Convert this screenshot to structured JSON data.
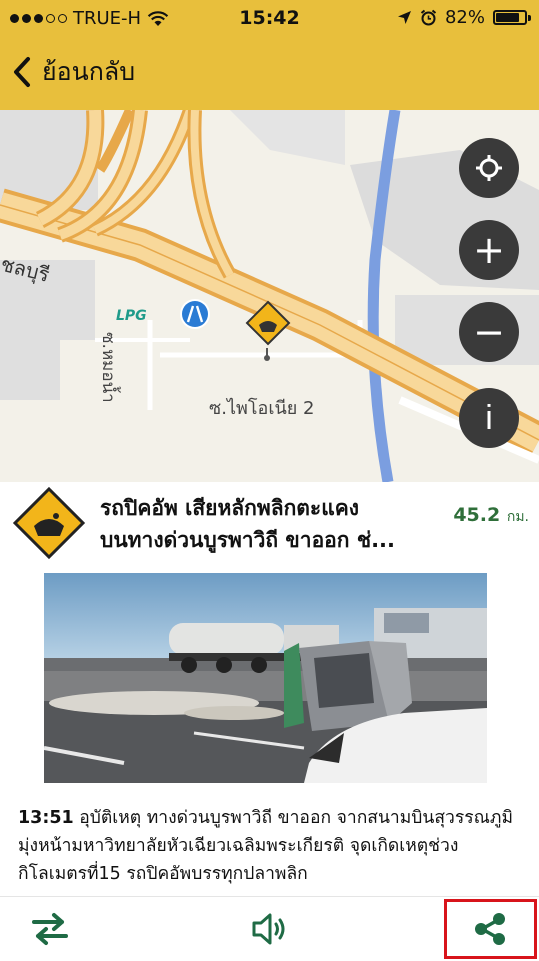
{
  "status": {
    "carrier": "TRUE-H",
    "time": "15:42",
    "battery": "82%",
    "battery_level": 0.82
  },
  "nav": {
    "back_label": "ย้อนกลับ"
  },
  "map": {
    "road_label_1": "-ชลบุรี",
    "road_label_2": "ซ.หมอน้ำ",
    "road_label_3": "ซ.ไพโอเนีย 2",
    "lpg_label": "LPG",
    "buttons": {
      "locate": "locate-icon",
      "zoom_in": "+",
      "zoom_out": "−",
      "info": "i"
    }
  },
  "incident": {
    "title": "รถปิคอัพ เสียหลักพลิกตะแคง\nบนทางด่วนบูรพาวิถี ขาออก ช่...",
    "distance_value": "45.2",
    "distance_unit": "กม.",
    "time": "13:51",
    "description": "อุบัติเหตุ ทางด่วนบูรพาวิถี ขาออก จากสนามบินสุวรรณภูมิ มุ่งหน้ามหาวิทยาลัยหัวเฉียวเฉลิมพระเกียรติ จุดเกิดเหตุช่วงกิโลเมตรที่15 รถปิคอัพบรรทุกปลาพลิก"
  },
  "toolbar": {
    "route_icon": "swap-route-icon",
    "sound_icon": "speaker-icon",
    "share_icon": "share-icon"
  },
  "colors": {
    "header": "#e8bf3c",
    "map_button": "#3a3a3a",
    "distance": "#2f6f3a",
    "highlight": "#d8141b",
    "toolbar_icon": "#1f6b45"
  }
}
